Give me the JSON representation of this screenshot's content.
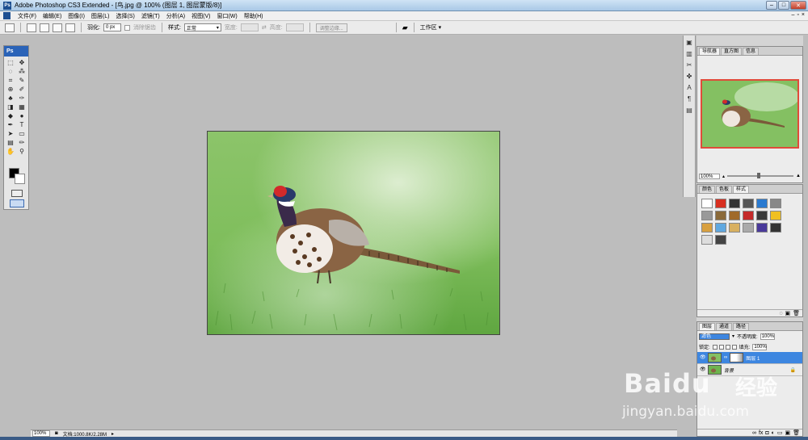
{
  "window": {
    "title": "Adobe Photoshop CS3 Extended - [鸟.jpg @ 100% (图层 1, 图层蒙版/8)]",
    "app_icon": "Ps",
    "controls": {
      "minimize": "–",
      "maximize": "□",
      "close": "✕"
    }
  },
  "menubar": {
    "items": [
      "文件(F)",
      "编辑(E)",
      "图像(I)",
      "图层(L)",
      "选择(S)",
      "滤镜(T)",
      "分析(A)",
      "视图(V)",
      "窗口(W)",
      "帮助(H)"
    ],
    "doc_controls": {
      "minimize": "–",
      "restore": "▫",
      "close": "×"
    }
  },
  "options": {
    "feather_label": "羽化:",
    "feather_value": "0 px",
    "antialias_label": "消除锯齿",
    "style_label": "样式:",
    "style_value": "正常",
    "width_label": "宽度:",
    "height_label": "高度:",
    "refine_edge": "调整边缘...",
    "workspace": "工作区 ▾"
  },
  "toolbox": {
    "logo": "Ps",
    "tools": [
      {
        "name": "rect-marquee-icon",
        "glyph": "⬚"
      },
      {
        "name": "move-icon",
        "glyph": "✥"
      },
      {
        "name": "lasso-icon",
        "glyph": "◌"
      },
      {
        "name": "magic-wand-icon",
        "glyph": "⁂"
      },
      {
        "name": "crop-icon",
        "glyph": "⌗"
      },
      {
        "name": "slice-icon",
        "glyph": "✎"
      },
      {
        "name": "healing-brush-icon",
        "glyph": "⊕"
      },
      {
        "name": "brush-icon",
        "glyph": "✐"
      },
      {
        "name": "clone-stamp-icon",
        "glyph": "♣"
      },
      {
        "name": "history-brush-icon",
        "glyph": "✑"
      },
      {
        "name": "eraser-icon",
        "glyph": "◨"
      },
      {
        "name": "gradient-icon",
        "glyph": "▦"
      },
      {
        "name": "blur-icon",
        "glyph": "◆"
      },
      {
        "name": "dodge-icon",
        "glyph": "●"
      },
      {
        "name": "pen-icon",
        "glyph": "✒"
      },
      {
        "name": "type-icon",
        "glyph": "T"
      },
      {
        "name": "path-select-icon",
        "glyph": "➤"
      },
      {
        "name": "shape-icon",
        "glyph": "▭"
      },
      {
        "name": "notes-icon",
        "glyph": "▤"
      },
      {
        "name": "eyedropper-icon",
        "glyph": "✏"
      },
      {
        "name": "hand-icon",
        "glyph": "✋"
      },
      {
        "name": "zoom-icon",
        "glyph": "⚲"
      }
    ]
  },
  "status": {
    "zoom": "100%",
    "doc_info": "文档:1000.8K/2.28M"
  },
  "dock": {
    "icons": [
      {
        "name": "navigator-dock-icon",
        "glyph": "▣"
      },
      {
        "name": "histogram-dock-icon",
        "glyph": "▥"
      },
      {
        "name": "tools-dock-icon",
        "glyph": "✂"
      },
      {
        "name": "brushes-dock-icon",
        "glyph": "✤"
      },
      {
        "name": "character-dock-icon",
        "glyph": "A"
      },
      {
        "name": "paragraph-dock-icon",
        "glyph": "¶"
      },
      {
        "name": "layer-comps-dock-icon",
        "glyph": "▤"
      }
    ]
  },
  "navigator_panel": {
    "tabs": [
      "导航器",
      "直方图",
      "信息"
    ],
    "zoom": "100%"
  },
  "styles_panel": {
    "tabs": [
      "颜色",
      "色板",
      "样式"
    ],
    "swatches": [
      "#ffffff",
      "#d83020",
      "#333333",
      "#555555",
      "#2a7ad0",
      "#888888",
      "#999999",
      "#8a6a3a",
      "#a06a2a",
      "#c42a2a",
      "#3a3a3a",
      "#f0c020",
      "#d8a040",
      "#60a8e0",
      "#d8b060",
      "#aaaaaa",
      "#4a3a9a",
      "#333333",
      "#dddddd",
      "#444444"
    ]
  },
  "layers_panel": {
    "tabs": [
      "图层",
      "通道",
      "路径"
    ],
    "blend_mode": "滤色",
    "opacity_label": "不透明度:",
    "opacity_value": "100%",
    "lock_label": "锁定:",
    "fill_label": "填充:",
    "fill_value": "100%",
    "layers": [
      {
        "name": "图层 1",
        "selected": true,
        "visible": true,
        "has_mask": true
      },
      {
        "name": "背景",
        "selected": false,
        "visible": true,
        "has_mask": false
      }
    ],
    "footer_icons": [
      "∞",
      "fx",
      "◘",
      "◐",
      "▭",
      "▣",
      "🗑"
    ]
  },
  "watermark": {
    "brand": "Baidu",
    "brand_cn": "经验",
    "url": "jingyan.baidu.com"
  },
  "colors": {
    "accent": "#3d86e0",
    "nav_frame": "#e04b3a",
    "canvas_bg": "#bdbdbd",
    "grass": "#6eb44e"
  }
}
